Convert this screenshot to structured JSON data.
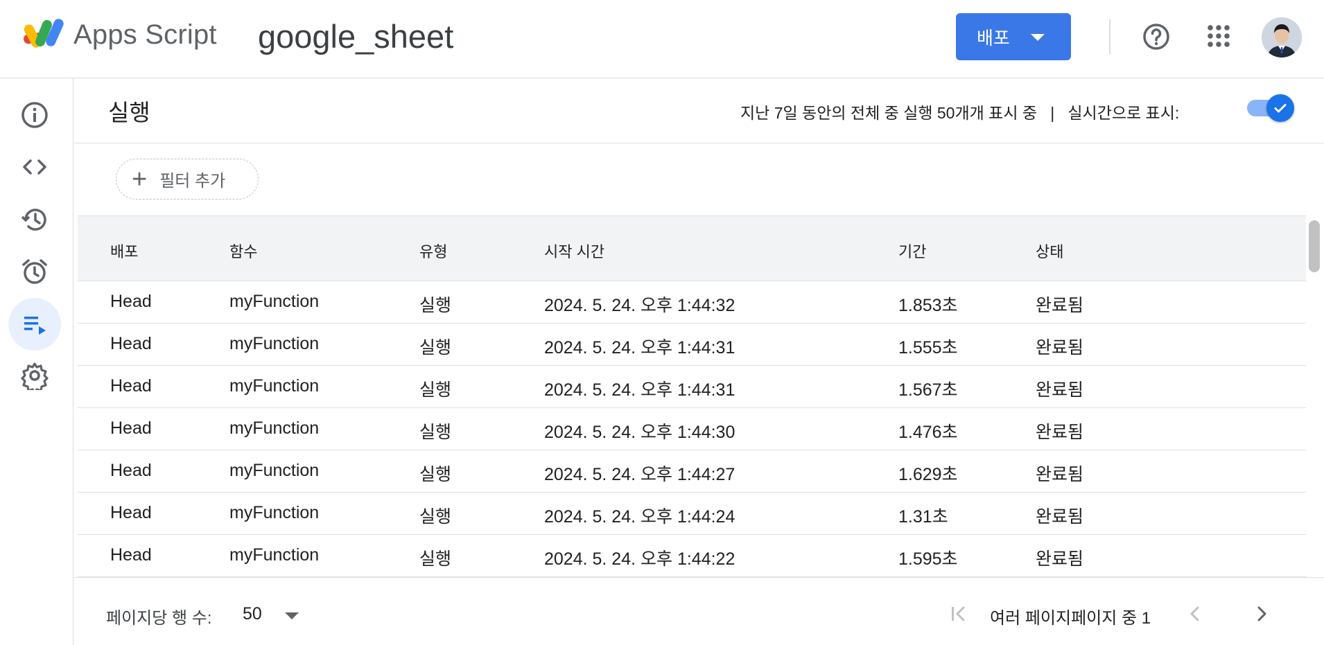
{
  "header": {
    "brand": "Apps Script",
    "project_name": "google_sheet",
    "deploy_label": "배포"
  },
  "sidebar": {
    "items": [
      {
        "name": "overview",
        "icon": "info-icon"
      },
      {
        "name": "editor",
        "icon": "code-icon"
      },
      {
        "name": "project-history",
        "icon": "history-icon"
      },
      {
        "name": "triggers",
        "icon": "alarm-clock-icon"
      },
      {
        "name": "executions",
        "icon": "executions-list-icon",
        "active": true
      },
      {
        "name": "settings",
        "icon": "gear-icon"
      }
    ]
  },
  "main": {
    "title": "실행",
    "summary": "지난 7일 동안의 전체 중 실행 50개개 표시 중   |   실시간으로 표시:",
    "realtime_toggle_on": true,
    "filter_label": "필터 추가"
  },
  "table": {
    "columns": [
      "배포",
      "함수",
      "유형",
      "시작 시간",
      "기간",
      "상태"
    ],
    "rows": [
      [
        "Head",
        "myFunction",
        "실행",
        "2024. 5. 24. 오후 1:44:32",
        "1.853초",
        "완료됨"
      ],
      [
        "Head",
        "myFunction",
        "실행",
        "2024. 5. 24. 오후 1:44:31",
        "1.555초",
        "완료됨"
      ],
      [
        "Head",
        "myFunction",
        "실행",
        "2024. 5. 24. 오후 1:44:31",
        "1.567초",
        "완료됨"
      ],
      [
        "Head",
        "myFunction",
        "실행",
        "2024. 5. 24. 오후 1:44:30",
        "1.476초",
        "완료됨"
      ],
      [
        "Head",
        "myFunction",
        "실행",
        "2024. 5. 24. 오후 1:44:27",
        "1.629초",
        "완료됨"
      ],
      [
        "Head",
        "myFunction",
        "실행",
        "2024. 5. 24. 오후 1:44:24",
        "1.31초",
        "완료됨"
      ],
      [
        "Head",
        "myFunction",
        "실행",
        "2024. 5. 24. 오후 1:44:22",
        "1.595초",
        "완료됨"
      ]
    ]
  },
  "footer": {
    "rows_per_page_label": "페이지당 행 수:",
    "rows_per_page_value": "50",
    "page_info": "여러 페이지페이지 중 1"
  },
  "colors": {
    "accent": "#3b78e7",
    "active_nav_bg": "#e8f0fe",
    "table_header_bg": "#f1f3f4"
  }
}
